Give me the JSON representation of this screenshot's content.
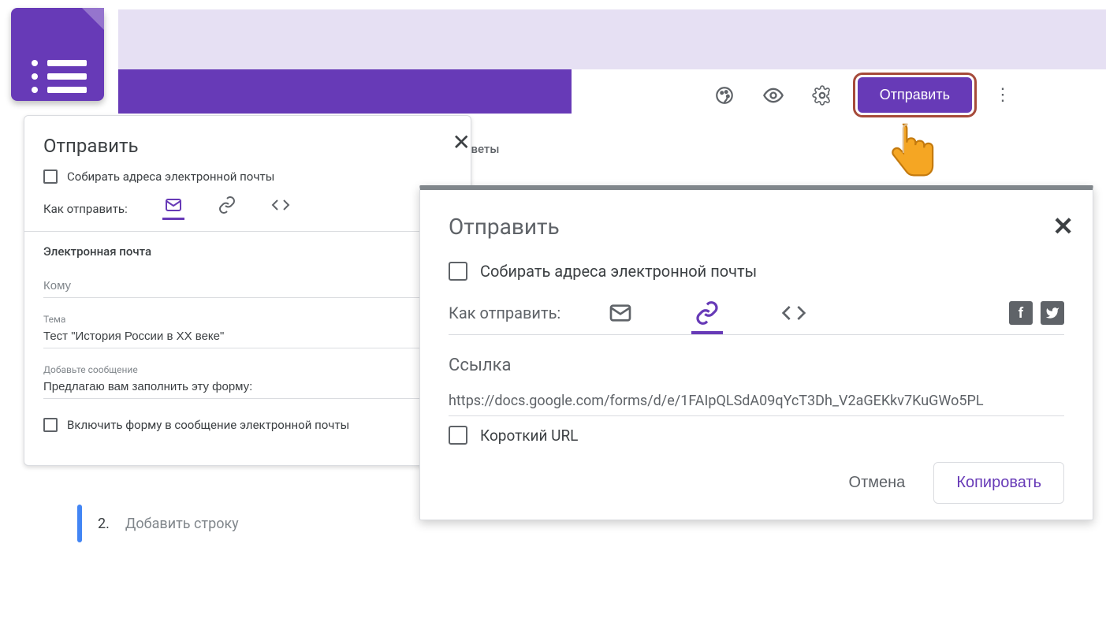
{
  "app": {
    "forms_icon_name": "google-forms-icon"
  },
  "toolbar": {
    "theme_icon": "palette-icon",
    "preview_icon": "eye-icon",
    "settings_icon": "gear-icon",
    "send_label": "Отправить",
    "more_icon": "more-vertical-icon"
  },
  "tab_fragment": "тветы",
  "dialog_left": {
    "title": "Отправить",
    "collect_emails": "Собирать адреса электронной почты",
    "send_via_label": "Как отправить:",
    "methods": {
      "email": "email-icon",
      "link": "link-icon",
      "embed": "embed-icon"
    },
    "active_method": "email",
    "section_title": "Электронная почта",
    "to_label": "Кому",
    "to_value": "",
    "subject_label": "Тема",
    "subject_value": "Тест \"История России в XX веке\"",
    "message_label": "Добавьте сообщение",
    "message_value": "Предлагаю вам заполнить эту форму:",
    "include_form": "Включить форму в сообщение электронной почты"
  },
  "step": {
    "number": "2.",
    "text": "Добавить строку"
  },
  "dialog_right": {
    "title": "Отправить",
    "collect_emails": "Собирать адреса электронной почты",
    "send_via_label": "Как отправить:",
    "methods": {
      "email": "email-icon",
      "link": "link-icon",
      "embed": "embed-icon"
    },
    "active_method": "link",
    "social": {
      "facebook": "f",
      "twitter": "twitter-icon"
    },
    "link_title": "Ссылка",
    "link_value": "https://docs.google.com/forms/d/e/1FAIpQLSdA09qYcT3Dh_V2aGEKkv7KuGWo5PL",
    "short_url": "Короткий URL",
    "cancel": "Отмена",
    "copy": "Копировать"
  }
}
